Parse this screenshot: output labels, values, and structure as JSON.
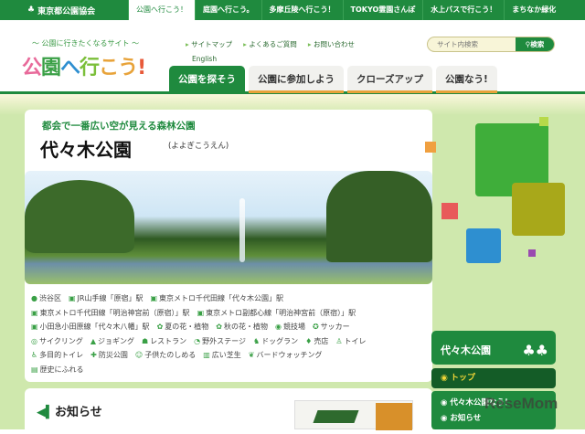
{
  "topbar": {
    "org": "東京都公園協会",
    "tabs": [
      "公園へ行こう！",
      "庭園へ行こう。",
      "多摩丘陵へ行こう！",
      "TOKYO霊園さんぽ",
      "水上バスで行こう！",
      "まちなか緑化"
    ]
  },
  "header": {
    "tagline": "〜 公園に行きたくなるサイト 〜",
    "logo": "公園へ行こう!",
    "links": [
      "サイトマップ",
      "よくあるご質問",
      "お問い合わせ"
    ],
    "english": "English",
    "search_placeholder": "サイト内検索",
    "search_button": "検索"
  },
  "nav": [
    "公園を探そう",
    "公園に参加しよう",
    "クローズアップ",
    "公園なう!"
  ],
  "park": {
    "subtitle": "都会で一番広い空が見える森林公園",
    "name": "代々木公園",
    "reading": "(よよぎこうえん)"
  },
  "info": [
    "渋谷区",
    "JR山手線「原宿」駅",
    "東京メトロ千代田線「代々木公園」駅",
    "東京メトロ千代田線「明治神宮前（原宿）」駅",
    "東京メトロ副都心線「明治神宮前（原宿）」駅",
    "小田急小田原線「代々木八幡」駅",
    "夏の花・植物",
    "秋の花・植物",
    "競技場",
    "サッカー",
    "サイクリング",
    "ジョギング",
    "レストラン",
    "野外ステージ",
    "ドッグラン",
    "売店",
    "トイレ",
    "多目的トイレ",
    "防災公園",
    "子供たのしめる",
    "広い芝生",
    "バードウォッチング",
    "歴史にふれる"
  ],
  "news": {
    "title": "お知らせ"
  },
  "sidebar": {
    "title": "代々木公園",
    "items": [
      "トップ",
      "代々木公園なう！",
      "お知らせ"
    ]
  },
  "watermark": "ReseMom"
}
